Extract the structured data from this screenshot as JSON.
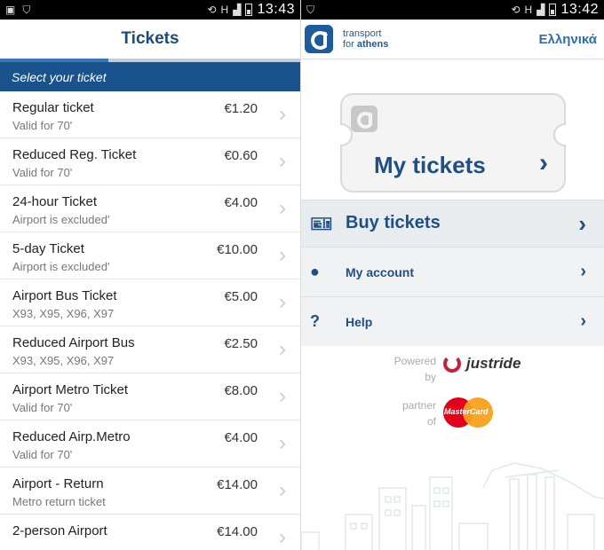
{
  "left": {
    "status": {
      "time": "13:43",
      "network": "H"
    },
    "title": "Tickets",
    "progress": 0.36,
    "section": "Select your ticket",
    "tickets": [
      {
        "name": "Regular ticket",
        "sub": "Valid for 70'",
        "price": "€1.20"
      },
      {
        "name": "Reduced Reg. Ticket",
        "sub": "Valid for 70'",
        "price": "€0.60"
      },
      {
        "name": "24-hour Ticket",
        "sub": "Airport is excluded'",
        "price": "€4.00"
      },
      {
        "name": "5-day Ticket",
        "sub": "Airport is excluded'",
        "price": "€10.00"
      },
      {
        "name": "Airport Bus Ticket",
        "sub": "X93, X95, X96, X97",
        "price": "€5.00"
      },
      {
        "name": "Reduced Airport Bus",
        "sub": "X93, X95, X96, X97",
        "price": "€2.50"
      },
      {
        "name": "Airport Metro Ticket",
        "sub": "Valid for 70'",
        "price": "€8.00"
      },
      {
        "name": "Reduced Airp.Metro",
        "sub": "Valid for 70'",
        "price": "€4.00"
      },
      {
        "name": "Airport - Return",
        "sub": "Metro return ticket",
        "price": "€14.00"
      },
      {
        "name": "2-person Airport",
        "sub": "",
        "price": "€14.00"
      }
    ]
  },
  "right": {
    "status": {
      "time": "13:42",
      "network": "H"
    },
    "brand": {
      "line1": "transport",
      "line2_a": "for ",
      "line2_b": "athens"
    },
    "language": "Ελληνικά",
    "my_tickets": "My tickets",
    "menu": {
      "buy": "Buy tickets",
      "account": "My account",
      "help": "Help"
    },
    "powered": {
      "line1": "Powered",
      "line2": "by",
      "vendor": "justride"
    },
    "partner": {
      "line1": "partner",
      "line2": "of",
      "brand": "MasterCard"
    }
  },
  "colors": {
    "primary": "#19528d",
    "accent": "#1f4f85",
    "mc_red": "#e3001b",
    "mc_orange": "#f8a11b",
    "justride_red": "#c4213b"
  },
  "icons": [
    "image-icon",
    "shield-icon",
    "rotate-icon",
    "signal-icon",
    "battery-icon",
    "chevron-right-icon",
    "ticket-icon",
    "user-icon",
    "question-icon"
  ]
}
